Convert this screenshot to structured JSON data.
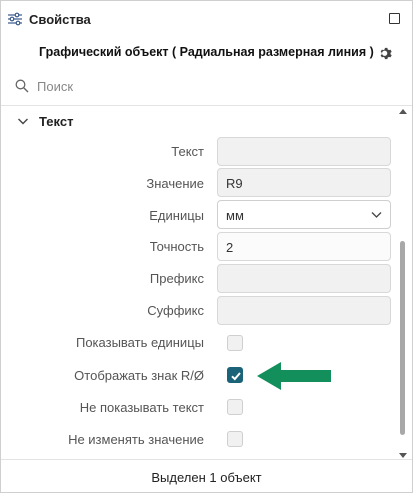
{
  "header": {
    "title": "Свойства",
    "icon": "sliders-icon"
  },
  "object": {
    "title": "Графический объект ( Радиальная размерная линия )"
  },
  "search": {
    "placeholder": "Поиск",
    "value": ""
  },
  "section": {
    "title": "Текст",
    "expanded": true
  },
  "properties": {
    "text": {
      "label": "Текст",
      "value": ""
    },
    "value": {
      "label": "Значение",
      "value": "R9"
    },
    "units": {
      "label": "Единицы",
      "value": "мм"
    },
    "precision": {
      "label": "Точность",
      "value": "2"
    },
    "prefix": {
      "label": "Префикс",
      "value": ""
    },
    "suffix": {
      "label": "Суффикс",
      "value": ""
    },
    "show_units": {
      "label": "Показывать единицы",
      "checked": false
    },
    "show_sign": {
      "label": "Отображать знак R/Ø",
      "checked": true
    },
    "hide_text": {
      "label": "Не показывать текст",
      "checked": false
    },
    "keep_value": {
      "label": "Не изменять значение",
      "checked": false
    }
  },
  "footer": {
    "status": "Выделен 1 объект"
  },
  "colors": {
    "accent": "#1a6378",
    "arrow": "#138f5c",
    "field_bg": "#f1f1f1"
  }
}
